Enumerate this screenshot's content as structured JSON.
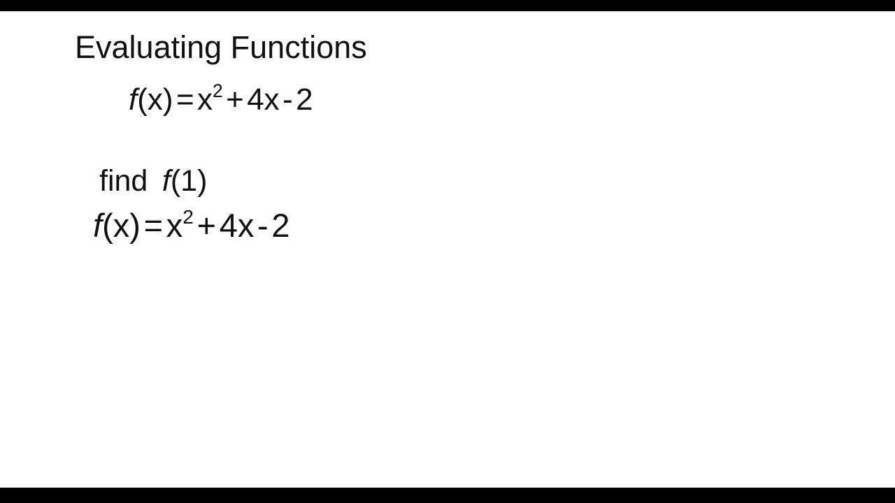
{
  "slide": {
    "background_color": "#ffffff",
    "text_color": "#111111",
    "letterbox_color": "#000000",
    "title": "Evaluating Functions",
    "lines": [
      {
        "id": "function-definition",
        "plain_text": "f(x) = x2 + 4x - 2",
        "fn_name": "f",
        "argument": "(x)",
        "equals": "=",
        "base": "x",
        "exponent": "2",
        "plus": "+",
        "linear_term": "4x",
        "minus": "-",
        "constant": "2"
      },
      {
        "id": "find-instruction",
        "prefix": "find",
        "fn_name": "f",
        "argument": "(1)",
        "plain_text": "find f(1)"
      },
      {
        "id": "function-restated",
        "plain_text": "f(x) = x2 + 4x - 2",
        "fn_name": "f",
        "argument": "(x)",
        "equals": "=",
        "base": "x",
        "exponent": "2",
        "plus": "+",
        "linear_term": "4x",
        "minus": "-",
        "constant": "2"
      }
    ]
  }
}
